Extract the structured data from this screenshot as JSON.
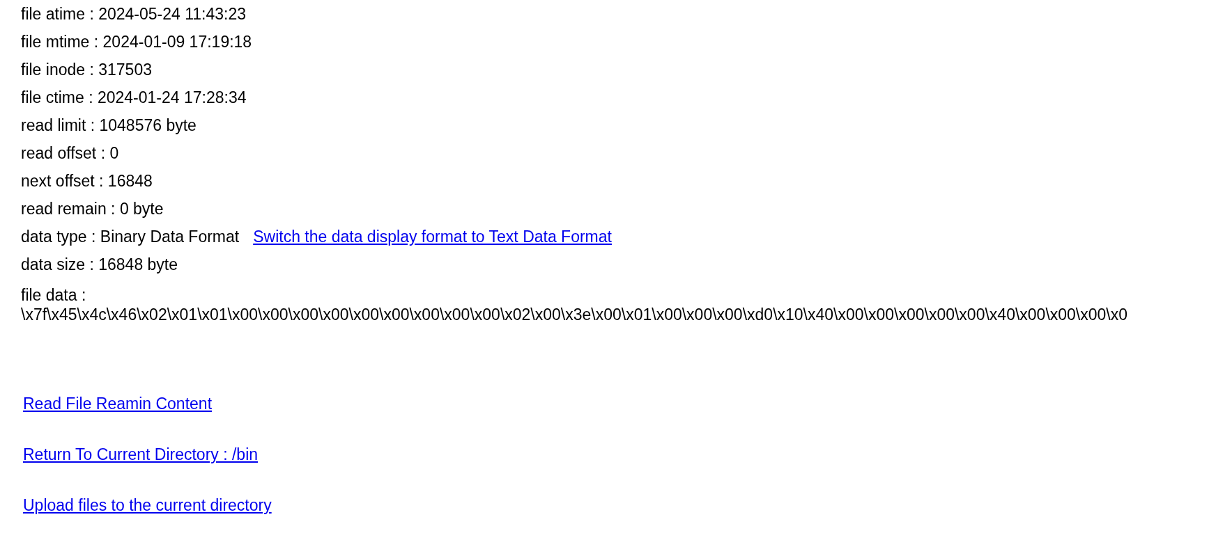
{
  "info_rows": [
    {
      "text": "file atime : 2024-05-24 11:43:23"
    },
    {
      "text": "file mtime : 2024-01-09 17:19:18"
    },
    {
      "text": "file inode : 317503"
    },
    {
      "text": "file ctime : 2024-01-24 17:28:34"
    },
    {
      "text": "read limit : 1048576 byte"
    },
    {
      "text": "read offset : 0"
    },
    {
      "text": "next offset : 16848"
    },
    {
      "text": "read remain : 0 byte"
    },
    {
      "text": "data type : Binary Data Format",
      "link": "Switch the data display format to Text Data Format"
    },
    {
      "text": "data size : 16848 byte"
    }
  ],
  "file_data": {
    "label": "file data :",
    "value": "\\x7f\\x45\\x4c\\x46\\x02\\x01\\x01\\x00\\x00\\x00\\x00\\x00\\x00\\x00\\x00\\x00\\x02\\x00\\x3e\\x00\\x01\\x00\\x00\\x00\\xd0\\x10\\x40\\x00\\x00\\x00\\x00\\x00\\x40\\x00\\x00\\x00\\x0"
  },
  "links": [
    "Read File Reamin Content",
    "Return To Current Directory : /bin",
    "Upload files to the current directory"
  ]
}
